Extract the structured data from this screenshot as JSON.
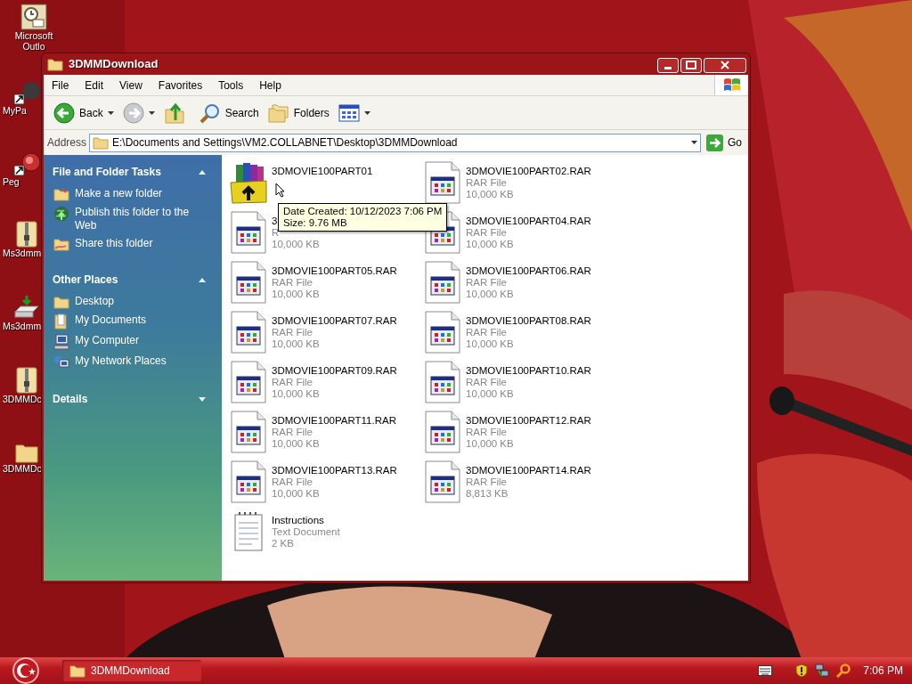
{
  "desktop_icons": [
    {
      "lines": [
        "Microsoft",
        "Outlo"
      ],
      "kind": "calendar"
    },
    {
      "lines": [
        "MyPa"
      ],
      "kind": "shortcut"
    },
    {
      "lines": [
        "Peg"
      ],
      "kind": "shortcut-red"
    },
    {
      "lines": [
        "Ms3dmm"
      ],
      "kind": "zip"
    },
    {
      "lines": [
        "Ms3dmm"
      ],
      "kind": "drive"
    },
    {
      "lines": [
        "3DMMDc"
      ],
      "kind": "zip"
    },
    {
      "lines": [
        "3DMMDc"
      ],
      "kind": "folder"
    }
  ],
  "window": {
    "title": "3DMMDownload",
    "menu": [
      "File",
      "Edit",
      "View",
      "Favorites",
      "Tools",
      "Help"
    ],
    "toolbar": [
      {
        "kind": "back",
        "label": "Back"
      },
      {
        "kind": "forward"
      },
      {
        "kind": "up"
      },
      {
        "kind": "search",
        "label": "Search"
      },
      {
        "kind": "folders",
        "label": "Folders"
      },
      {
        "kind": "views"
      }
    ],
    "address": {
      "label": "Address",
      "value": "E:\\Documents and Settings\\VM2.COLLABNET\\Desktop\\3DMMDownload",
      "go": "Go"
    },
    "task_panes": [
      {
        "title": "File and Folder Tasks",
        "expanded": true,
        "items": [
          {
            "label": "Make a new folder",
            "kind": "newfolder"
          },
          {
            "label": "Publish this folder to the Web",
            "kind": "globe"
          },
          {
            "label": "Share this folder",
            "kind": "share"
          }
        ]
      },
      {
        "title": "Other Places",
        "expanded": true,
        "items": [
          {
            "label": "Desktop",
            "kind": "folder"
          },
          {
            "label": "My Documents",
            "kind": "documents"
          },
          {
            "label": "My Computer",
            "kind": "computer"
          },
          {
            "label": "My Network Places",
            "kind": "network"
          }
        ]
      },
      {
        "title": "Details",
        "expanded": false
      }
    ],
    "files": [
      {
        "name": "3DMOVIE100PART01",
        "kind": "winrar"
      },
      {
        "name": "3DMOVIE100PART02.RAR",
        "type": "RAR File",
        "size": "10,000 KB",
        "kind": "rar"
      },
      {
        "name": "3",
        "type": "R",
        "size": "10,000 KB",
        "kind": "rar"
      },
      {
        "name": "3DMOVIE100PART04.RAR",
        "type": "RAR File",
        "size": "10,000 KB",
        "kind": "rar"
      },
      {
        "name": "3DMOVIE100PART05.RAR",
        "type": "RAR File",
        "size": "10,000 KB",
        "kind": "rar"
      },
      {
        "name": "3DMOVIE100PART06.RAR",
        "type": "RAR File",
        "size": "10,000 KB",
        "kind": "rar"
      },
      {
        "name": "3DMOVIE100PART07.RAR",
        "type": "RAR File",
        "size": "10,000 KB",
        "kind": "rar"
      },
      {
        "name": "3DMOVIE100PART08.RAR",
        "type": "RAR File",
        "size": "10,000 KB",
        "kind": "rar"
      },
      {
        "name": "3DMOVIE100PART09.RAR",
        "type": "RAR File",
        "size": "10,000 KB",
        "kind": "rar"
      },
      {
        "name": "3DMOVIE100PART10.RAR",
        "type": "RAR File",
        "size": "10,000 KB",
        "kind": "rar"
      },
      {
        "name": "3DMOVIE100PART11.RAR",
        "type": "RAR File",
        "size": "10,000 KB",
        "kind": "rar"
      },
      {
        "name": "3DMOVIE100PART12.RAR",
        "type": "RAR File",
        "size": "10,000 KB",
        "kind": "rar"
      },
      {
        "name": "3DMOVIE100PART13.RAR",
        "type": "RAR File",
        "size": "10,000 KB",
        "kind": "rar"
      },
      {
        "name": "3DMOVIE100PART14.RAR",
        "type": "RAR File",
        "size": "8,813 KB",
        "kind": "rar"
      },
      {
        "name": "Instructions",
        "type": "Text Document",
        "size": "2 KB",
        "kind": "text"
      }
    ],
    "tooltip": {
      "lines": [
        "Date Created: 10/12/2023 7:06 PM",
        "Size: 9.76 MB"
      ]
    }
  },
  "taskbar": {
    "tasks": [
      {
        "label": "3DMMDownload",
        "selected": true
      }
    ],
    "clock": "7:06 PM"
  }
}
